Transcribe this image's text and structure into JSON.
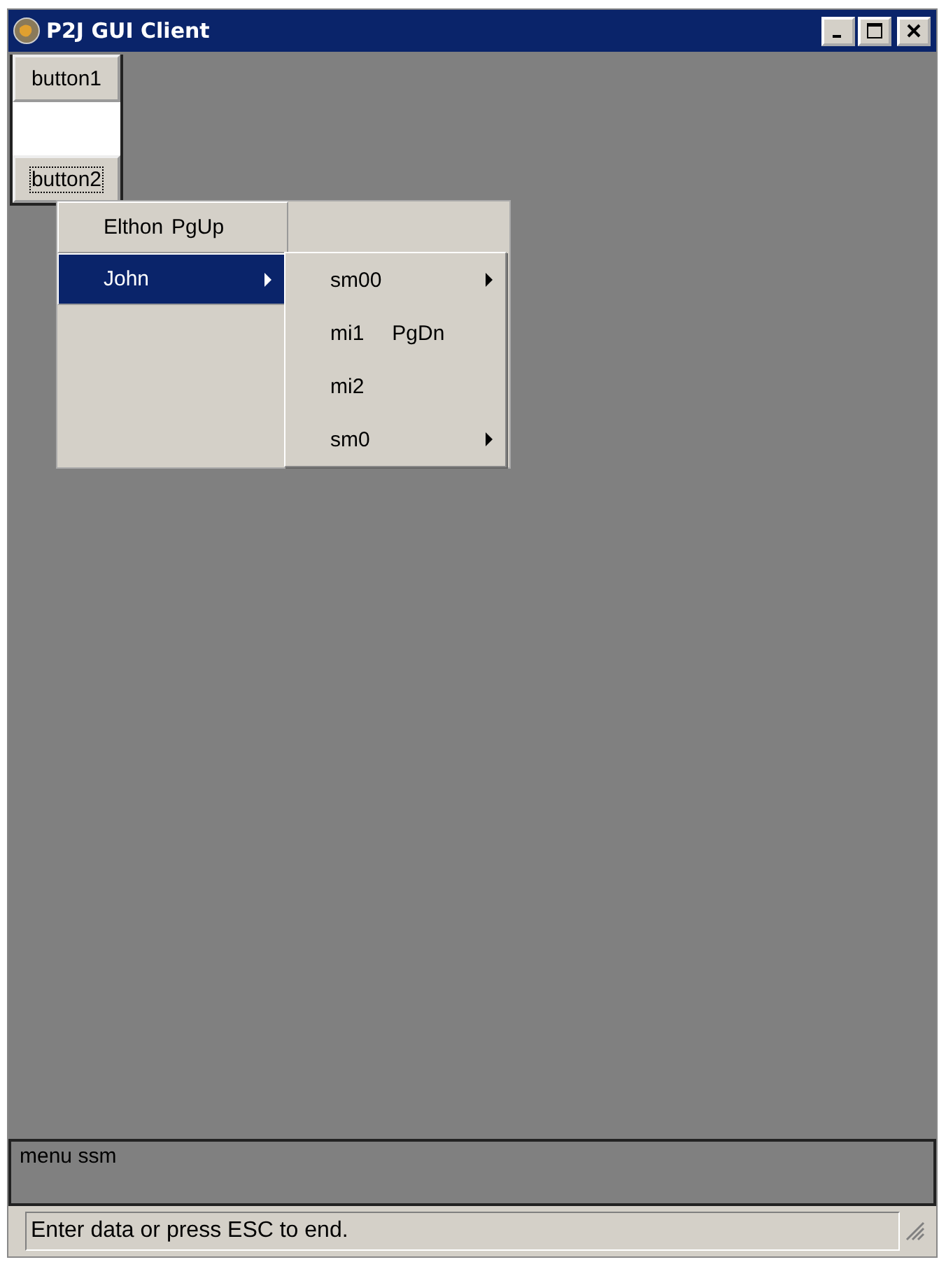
{
  "window": {
    "title": "P2J GUI Client"
  },
  "buttons": [
    {
      "label": "button1",
      "focused": false
    },
    {
      "label": "button2",
      "focused": true
    }
  ],
  "menu": {
    "items": [
      {
        "label": "Elthon",
        "shortcut": "PgUp",
        "kind": "command",
        "selected": false
      },
      {
        "label": "John",
        "kind": "submenu",
        "selected": true
      }
    ],
    "submenu": {
      "items": [
        {
          "label": "sm00",
          "kind": "submenu",
          "selected": false
        },
        {
          "label": "mi1",
          "shortcut": "PgDn",
          "kind": "command",
          "selected": false
        },
        {
          "label": "mi2",
          "kind": "command",
          "selected": false
        },
        {
          "label": "sm0",
          "kind": "submenu",
          "selected": false
        }
      ]
    }
  },
  "message": {
    "text": "menu ssm"
  },
  "status_bar": {
    "text": "Enter data or press ESC to end."
  }
}
